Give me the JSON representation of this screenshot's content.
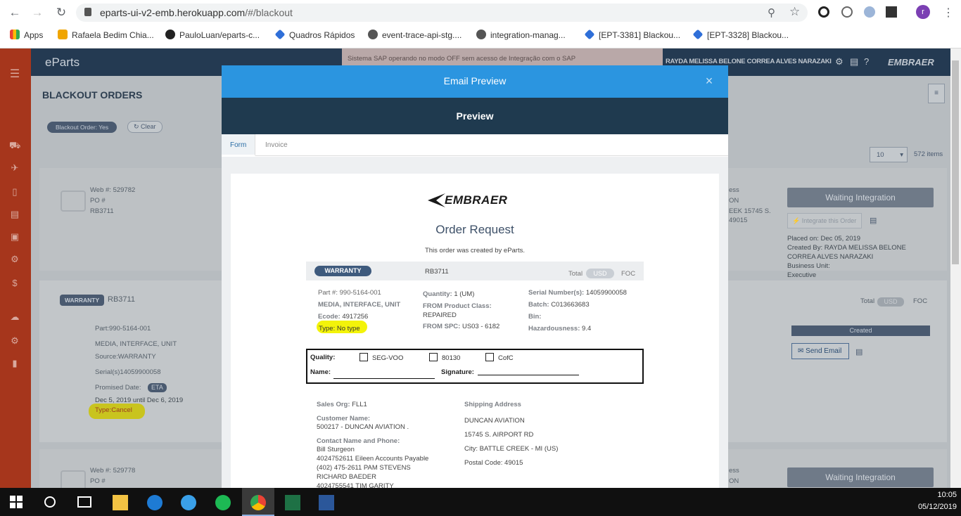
{
  "browser": {
    "url_host": "eparts-ui-v2-emb.herokuapp.com",
    "url_path": "/#/blackout",
    "profile_initial": "r",
    "bookmarks": [
      {
        "label": "Apps"
      },
      {
        "label": "Rafaela Bedim Chia..."
      },
      {
        "label": "PauloLuan/eparts-c..."
      },
      {
        "label": "Quadros Rápidos"
      },
      {
        "label": "event-trace-api-stg...."
      },
      {
        "label": "integration-manag..."
      },
      {
        "label": "[EPT-3381] Blackou..."
      },
      {
        "label": "[EPT-3328] Blackou..."
      }
    ]
  },
  "app": {
    "brand": "eParts",
    "sap_banner": "Sistema SAP operando no modo OFF sem acesso de Integração com o SAP",
    "user_name": "RAYDA MELISSA BELONE CORREA ALVES NARAZAKI",
    "logo_text": "EMBRAER",
    "page_title": "BLACKOUT ORDERS",
    "filter_chip": "Blackout Order: Yes",
    "clear_button": "Clear",
    "page_size": "10",
    "items_count": "572 items",
    "order1": {
      "web": "Web #: 529782",
      "po": "PO #",
      "ref": "RB3711",
      "status_button": "Waiting Integration",
      "integrate_button": "Integrate this Order",
      "placed_on": "Placed on: Dec 05, 2019",
      "created_by": "Created By: RAYDA MELISSA BELONE CORREA ALVES NARAZAKI",
      "business_unit": "Business Unit:",
      "business_unit_value": "Executive",
      "partial_right1": "ess",
      "partial_right2": "ON",
      "partial_right3": "EEK 15745 S.",
      "partial_right4": "49015"
    },
    "line1": {
      "badge": "WARRANTY",
      "ref": "RB3711",
      "part": "Part:990-5164-001",
      "desc": "MEDIA, INTERFACE, UNIT",
      "source": "Source:WARRANTY",
      "serial": "Serial(s)14059900058",
      "promised_label": "Promised Date:",
      "eta_badge": "ETA",
      "dates": "Dec 5, 2019 until Dec 6, 2019",
      "type_label": "Type:",
      "type_value": "Cancel",
      "total_label": "Total",
      "currency": "USD",
      "foc": "FOC",
      "created_badge": "Created",
      "send_email_button": "Send Email"
    },
    "order2": {
      "web": "Web #: 529778",
      "po": "PO #",
      "status_button": "Waiting Integration",
      "partial_right1": "ess",
      "partial_right2": "ON"
    }
  },
  "modal": {
    "title": "Email Preview",
    "close": "×",
    "preview_header": "Preview",
    "tabs": [
      {
        "label": "Form"
      },
      {
        "label": "Invoice"
      }
    ],
    "doc": {
      "logo": "EMBRAER",
      "heading": "Order Request",
      "subtitle": "This order was created by eParts.",
      "badge": "WARRANTY",
      "ref": "RB3711",
      "total_label": "Total",
      "currency": "USD",
      "foc": "FOC",
      "part": "Part #: 990-5164-001",
      "desc": "MEDIA, INTERFACE, UNIT",
      "ecode_label": "Ecode:",
      "ecode": "4917256",
      "type": "Type: No type",
      "quantity_label": "Quantity:",
      "quantity": "1 (UM)",
      "from_class_label": "FROM Product Class:",
      "from_class": "REPAIRED",
      "from_spc_label": "FROM SPC:",
      "from_spc": "US03 - 6182",
      "serial_label": "Serial Number(s):",
      "serial": "14059900058",
      "batch_label": "Batch:",
      "batch": "C013663683",
      "bin_label": "Bin:",
      "hazard_label": "Hazardousness:",
      "hazard": "9.4",
      "quality_label": "Quality:",
      "checks": [
        "SEG-VOO",
        "80130",
        "CofC"
      ],
      "name_label": "Name:",
      "signature_label": "Signature:",
      "sales_org_label": "Sales Org:",
      "sales_org": "FLL1",
      "customer_label": "Customer Name:",
      "customer": "500217 - DUNCAN AVIATION .",
      "contact_label": "Contact Name and Phone:",
      "contacts": [
        "Bill Sturgeon",
        "4024752611 Eileen Accounts Payable",
        "(402) 475-2611 PAM STEVENS",
        "RICHARD BAEDER",
        "4024755541 TIM GARITY"
      ],
      "shipping_label": "Shipping Address",
      "ship_name": "DUNCAN AVIATION",
      "ship_street": "15745 S. AIRPORT RD",
      "ship_city": "City: BATTLE CREEK - MI (US)",
      "ship_postal": "Postal Code: 49015"
    }
  },
  "taskbar": {
    "time": "10:05",
    "date": "05/12/2019"
  }
}
